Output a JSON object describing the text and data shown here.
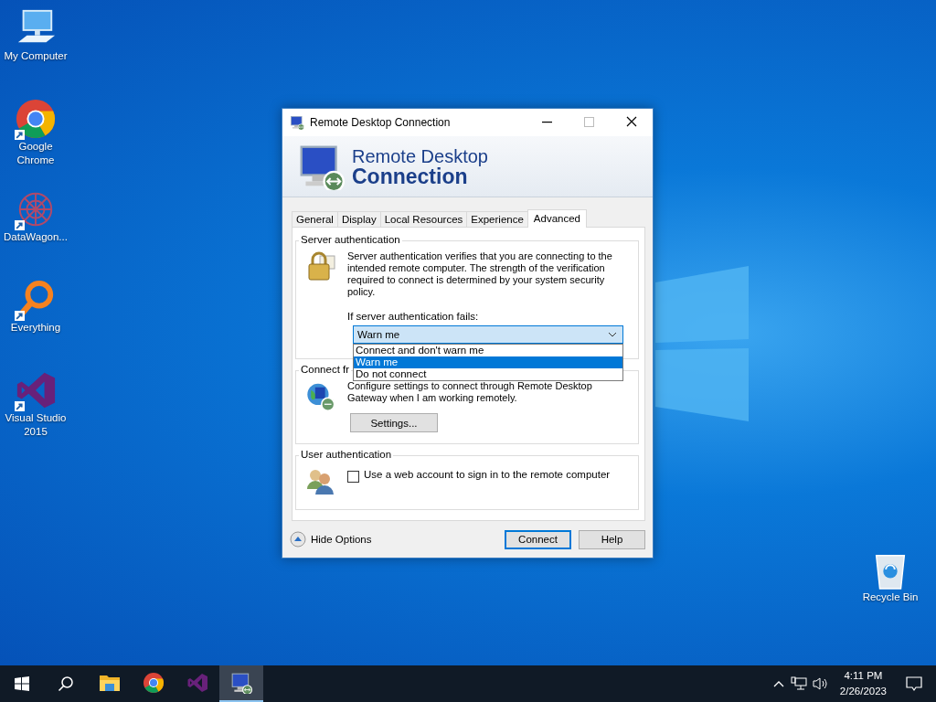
{
  "desktop_icons": [
    {
      "label": "My Computer",
      "kind": "computer",
      "shortcut": false
    },
    {
      "label": "Google Chrome",
      "kind": "chrome",
      "shortcut": true
    },
    {
      "label": "DataWagon...",
      "kind": "datawagon",
      "shortcut": true
    },
    {
      "label": "Everything",
      "kind": "everything",
      "shortcut": true
    },
    {
      "label": "Visual Studio 2015",
      "kind": "vs",
      "shortcut": true
    },
    {
      "label": "Recycle Bin",
      "kind": "recycle",
      "shortcut": false
    }
  ],
  "window": {
    "title": "Remote Desktop Connection",
    "banner": {
      "line_1": "Remote Desktop",
      "line_2": "Connection"
    },
    "tabs": [
      {
        "label": "General",
        "selected": false
      },
      {
        "label": "Display",
        "selected": false
      },
      {
        "label": "Local Resources",
        "selected": false
      },
      {
        "label": "Experience",
        "selected": false
      },
      {
        "label": "Advanced",
        "selected": true
      }
    ],
    "server_authentication": {
      "legend": "Server authentication",
      "description": "Server authentication verifies that you are connecting to the intended remote computer. The strength of the verification required to connect is determined by your system security policy.",
      "prompt": "If server authentication fails:",
      "dropdown": {
        "value": "Warn me",
        "expanded": true,
        "options": [
          {
            "label": "Connect and don't warn me",
            "selected": false
          },
          {
            "label": "Warn me",
            "selected": true
          },
          {
            "label": "Do not connect",
            "selected": false
          }
        ]
      }
    },
    "connect_from_anywhere": {
      "legend": "Connect fr",
      "description": "Configure settings to connect through Remote Desktop Gateway when I am working remotely.",
      "button": "Settings..."
    },
    "user_authentication": {
      "legend": "User authentication",
      "checkbox": {
        "label": "Use a web account to sign in to the remote computer",
        "checked": false
      }
    },
    "footer": {
      "toggle": "Hide Options",
      "buttons": [
        {
          "label": "Connect",
          "default": true
        },
        {
          "label": "Help",
          "default": false
        }
      ]
    }
  },
  "taskbar": {
    "apps": [
      {
        "kind": "explorer",
        "active": false
      },
      {
        "kind": "chrome",
        "active": false
      },
      {
        "kind": "vs",
        "active": false
      },
      {
        "kind": "rdc",
        "active": true
      }
    ],
    "time": "4:11 PM",
    "date": "2/26/2023"
  }
}
